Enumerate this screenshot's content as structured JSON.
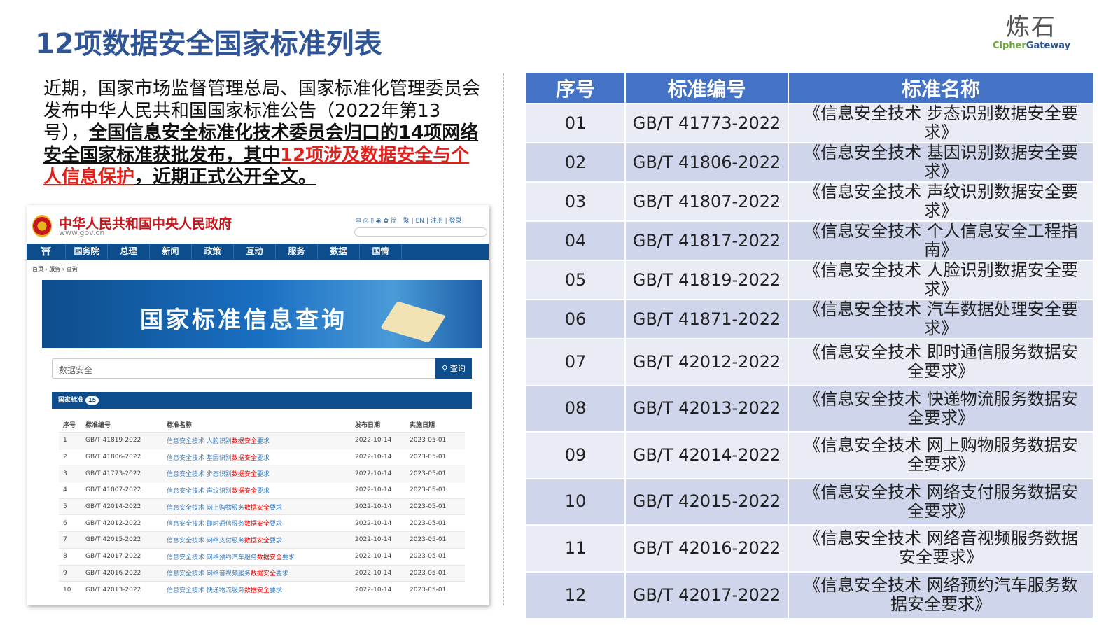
{
  "title": "12项数据安全国家标准列表",
  "logo": {
    "cn": "炼石",
    "en1": "Cipher",
    "en2": "Gateway"
  },
  "paragraph": {
    "p1": "近期，国家市场监督管理总局、国家标准化管理委员会发布中华人民共和国国家标准公告（2022年第13号），",
    "p2": "全国信息安全标准化技术委员会归口的14项网络安全国家标准获批发布，其中",
    "p3": "12项涉及数据安全与个人信息保护",
    "p4": "，近期正式公开全文。"
  },
  "gov": {
    "title": "中华人民共和国中央人民政府",
    "url": "www.gov.cn",
    "top_links": "✉ ◎ ▯ ◉ ✿ 简 | 繁 | EN | 注册 | 登录",
    "nav": [
      "国务院",
      "总理",
      "新闻",
      "政策",
      "互动",
      "服务",
      "数据",
      "国情"
    ],
    "breadcrumb": [
      "首页",
      "服务",
      "查询"
    ],
    "banner": "国家标准信息查询",
    "search_value": "数据安全",
    "search_button": "查询",
    "panel_title": "国家标准",
    "panel_count": "15",
    "headers": [
      "序号",
      "标准编号",
      "标准名称",
      "发布日期",
      "实施日期"
    ],
    "rows": [
      [
        "1",
        "GB/T 41819-2022",
        "信息安全技术 人脸识别",
        "数据安全",
        "要求",
        "2022-10-14",
        "2023-05-01"
      ],
      [
        "2",
        "GB/T 41806-2022",
        "信息安全技术 基因识别",
        "数据安全",
        "要求",
        "2022-10-14",
        "2023-05-01"
      ],
      [
        "3",
        "GB/T 41773-2022",
        "信息安全技术 步态识别",
        "数据安全",
        "要求",
        "2022-10-14",
        "2023-05-01"
      ],
      [
        "4",
        "GB/T 41807-2022",
        "信息安全技术 声纹识别",
        "数据安全",
        "要求",
        "2022-10-14",
        "2023-05-01"
      ],
      [
        "5",
        "GB/T 42014-2022",
        "信息安全技术 网上购物服务",
        "数据安全",
        "要求",
        "2022-10-14",
        "2023-05-01"
      ],
      [
        "6",
        "GB/T 42012-2022",
        "信息安全技术 即时通信服务",
        "数据安全",
        "要求",
        "2022-10-14",
        "2023-05-01"
      ],
      [
        "7",
        "GB/T 42015-2022",
        "信息安全技术 网络支付服务",
        "数据安全",
        "要求",
        "2022-10-14",
        "2023-05-01"
      ],
      [
        "8",
        "GB/T 42017-2022",
        "信息安全技术 网络预约汽车服务",
        "数据安全",
        "要求",
        "2022-10-14",
        "2023-05-01"
      ],
      [
        "9",
        "GB/T 42016-2022",
        "信息安全技术 网络音视频服务",
        "数据安全",
        "要求",
        "2022-10-14",
        "2023-05-01"
      ],
      [
        "10",
        "GB/T 42013-2022",
        "信息安全技术 快递物流服务",
        "数据安全",
        "要求",
        "2022-10-14",
        "2023-05-01"
      ]
    ]
  },
  "table": {
    "headers": [
      "序号",
      "标准编号",
      "标准名称"
    ],
    "rows": [
      [
        "01",
        "GB/T 41773-2022",
        "《信息安全技术 步态识别数据安全要求》"
      ],
      [
        "02",
        "GB/T 41806-2022",
        "《信息安全技术 基因识别数据安全要求》"
      ],
      [
        "03",
        "GB/T 41807-2022",
        "《信息安全技术 声纹识别数据安全要求》"
      ],
      [
        "04",
        "GB/T 41817-2022",
        "《信息安全技术 个人信息安全工程指南》"
      ],
      [
        "05",
        "GB/T 41819-2022",
        "《信息安全技术 人脸识别数据安全要求》"
      ],
      [
        "06",
        "GB/T 41871-2022",
        "《信息安全技术 汽车数据处理安全要求》"
      ],
      [
        "07",
        "GB/T 42012-2022",
        "《信息安全技术 即时通信服务数据安全要求》"
      ],
      [
        "08",
        "GB/T 42013-2022",
        "《信息安全技术 快递物流服务数据安全要求》"
      ],
      [
        "09",
        "GB/T 42014-2022",
        "《信息安全技术 网上购物服务数据安全要求》"
      ],
      [
        "10",
        "GB/T 42015-2022",
        "《信息安全技术 网络支付服务数据安全要求》"
      ],
      [
        "11",
        "GB/T 42016-2022",
        "《信息安全技术 网络音视频服务数据安全要求》"
      ],
      [
        "12",
        "GB/T 42017-2022",
        "《信息安全技术 网络预约汽车服务数据安全要求》"
      ]
    ]
  }
}
